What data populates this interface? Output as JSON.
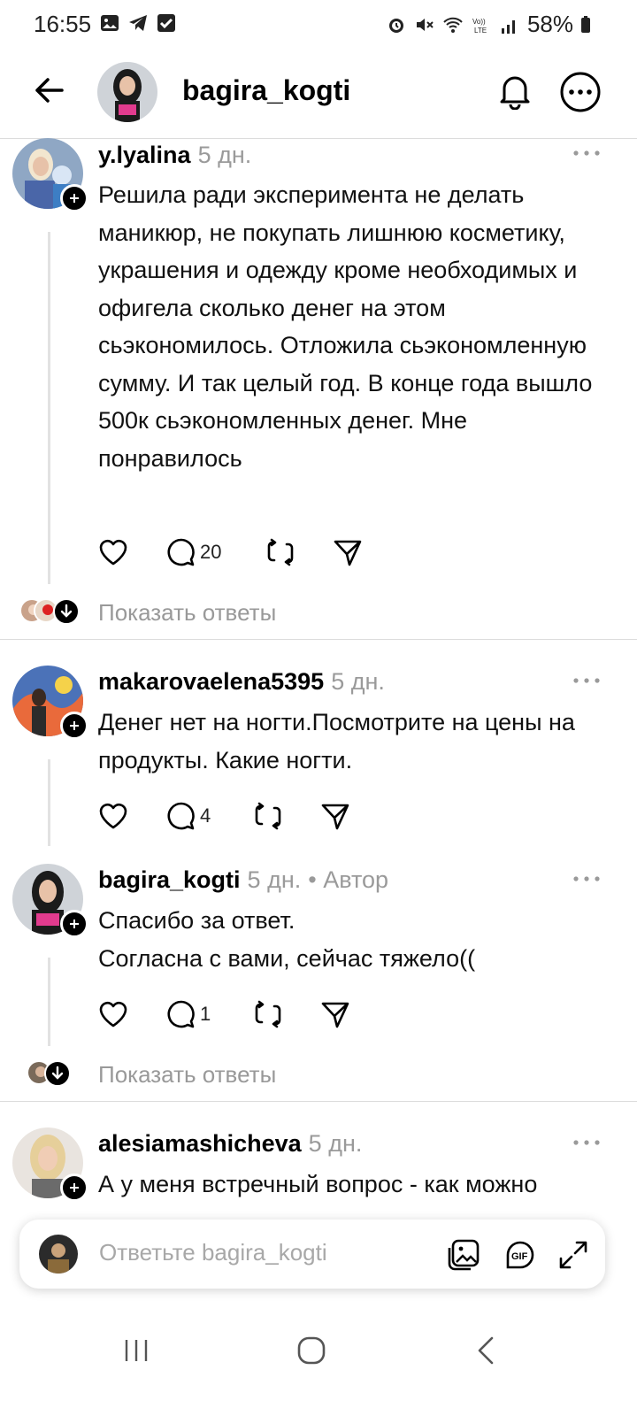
{
  "status_bar": {
    "time": "16:55",
    "battery": "58%",
    "left_icons": [
      "gallery-icon",
      "telegram-icon",
      "checkbox-icon"
    ],
    "right_icons": [
      "alarm-icon",
      "mute-icon",
      "wifi-icon",
      "volte-icon",
      "signal-icon",
      "battery-icon"
    ]
  },
  "header": {
    "title": "bagira_kogti"
  },
  "posts": [
    {
      "username": "y.lyalina",
      "time": "5 дн.",
      "author_tag": "",
      "text": "Решила ради эксперимента не делать маникюр, не покупать лишнюю косметику, украшения и одежду кроме необходимых и офигела сколько денег на этом сьэкономилось. Отложила сьэкономленную сумму. И так целый год. В конце года вышло 500к сьэкономленных денег. Мне понравилось",
      "reply_count": "20",
      "show_replies": "Показать ответы"
    },
    {
      "username": "makarovaelena5395",
      "time": "5 дн.",
      "author_tag": "",
      "text": "Денег нет на ногти.Посмотрите на цены на продукты. Какие ногти.",
      "reply_count": "4",
      "show_replies": ""
    },
    {
      "username": "bagira_kogti",
      "time": "5 дн.",
      "author_tag": "• Автор",
      "text": "Спасибо за ответ.\nСогласна с вами, сейчас тяжело((",
      "reply_count": "1",
      "show_replies": "Показать ответы"
    },
    {
      "username": "alesiamashicheva",
      "time": "5 дн.",
      "author_tag": "",
      "text": "А у меня встречный вопрос - как можно",
      "reply_count": "",
      "show_replies": ""
    }
  ],
  "reply_bar": {
    "placeholder": "Ответьте bagira_kogti"
  },
  "colors": {
    "text": "#000000",
    "muted": "#9a9a9a",
    "divider": "#dcdcdc",
    "thread_line": "#e2e2e2"
  }
}
